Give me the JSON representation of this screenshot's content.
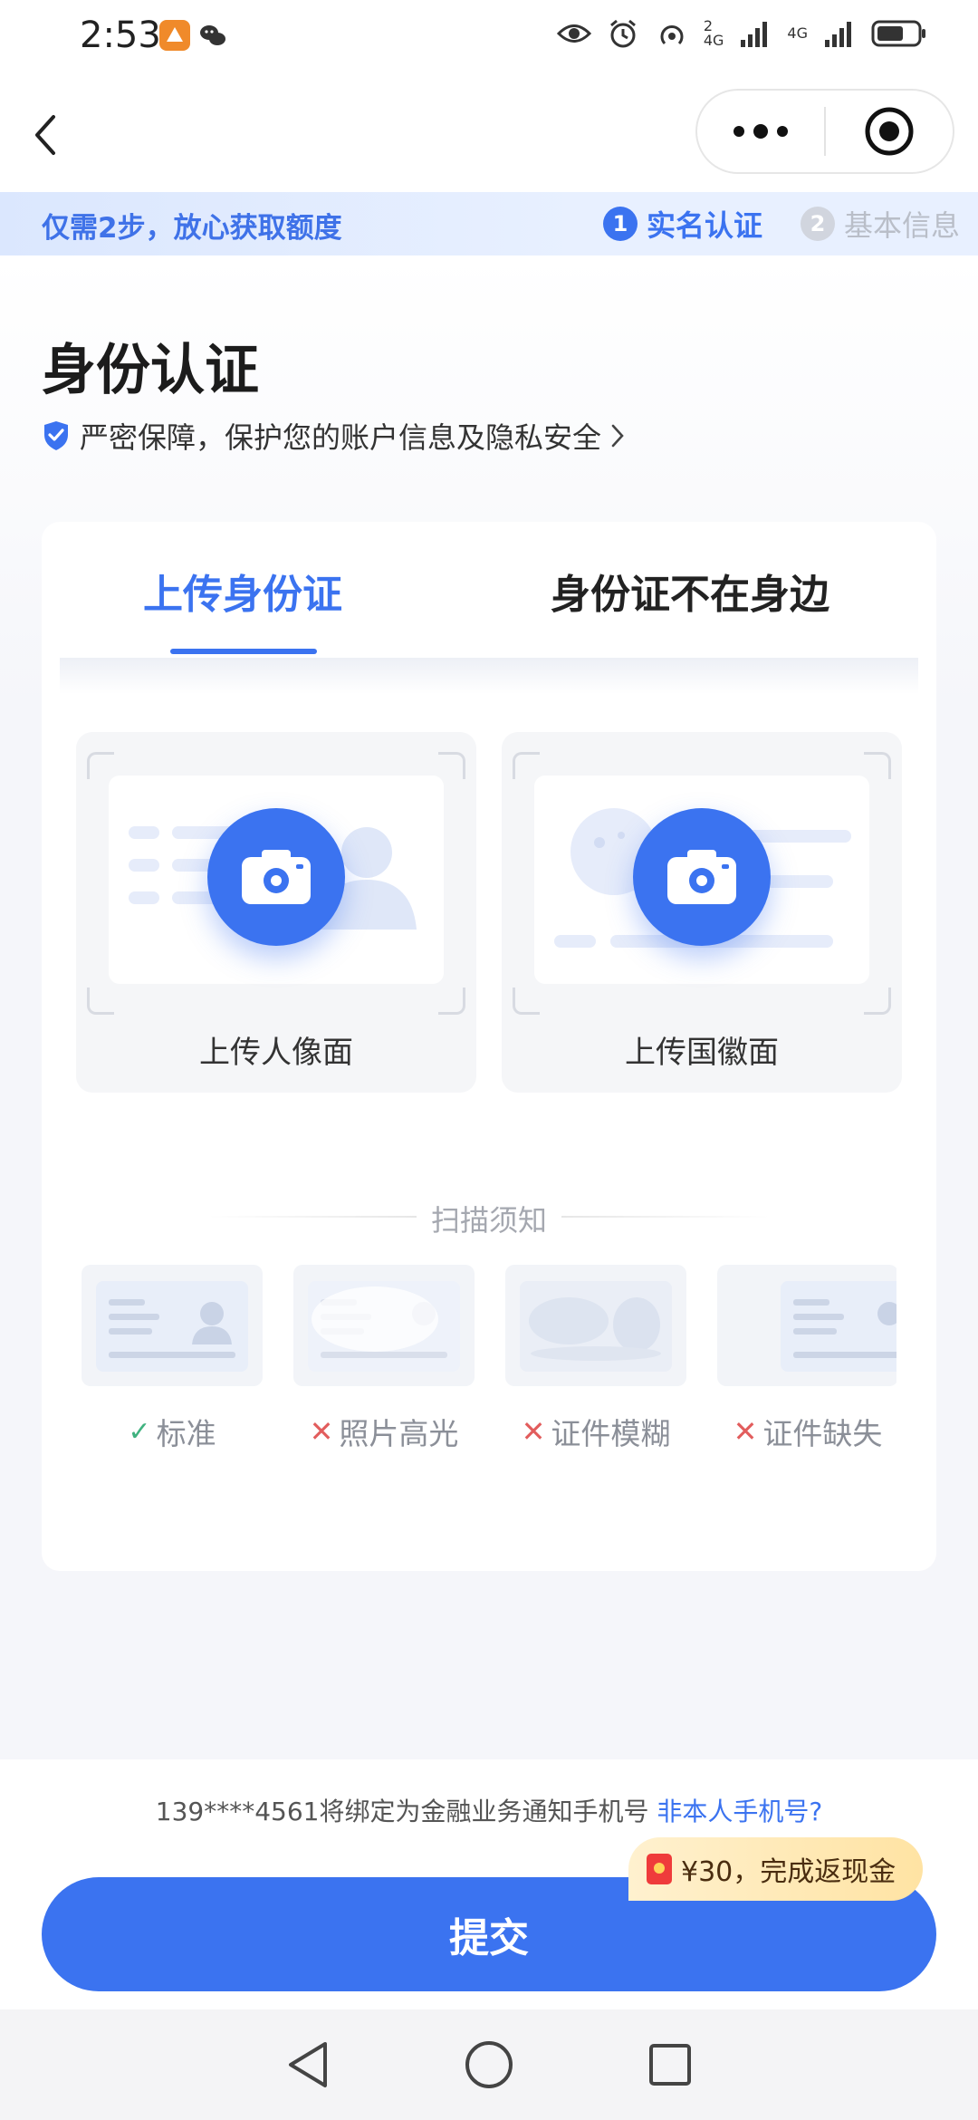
{
  "status_bar": {
    "time": "2:53",
    "net_1_sup": "2",
    "net_1_type": "4G",
    "net_2_type": "4G",
    "icons": [
      "app-notification-icon",
      "wechat-icon",
      "eye-icon",
      "alarm-icon",
      "hotspot-icon",
      "signal-icon",
      "signal-icon",
      "battery-icon"
    ]
  },
  "nav": {
    "icons": [
      "back-arrow-icon",
      "more-dots-icon",
      "mini-program-close-icon"
    ]
  },
  "steps": {
    "tagline": "仅需2步，放心获取额度",
    "items": [
      {
        "num": "1",
        "label": "实名认证",
        "active": true
      },
      {
        "num": "2",
        "label": "基本信息",
        "active": false
      }
    ]
  },
  "header": {
    "title": "身份认证",
    "security_text": "严密保障，保护您的账户信息及隐私安全",
    "security_icon": "shield-check-icon"
  },
  "tabs": [
    {
      "label": "上传身份证",
      "active": true
    },
    {
      "label": "身份证不在身边",
      "active": false
    }
  ],
  "upload": {
    "portrait_label": "上传人像面",
    "emblem_label": "上传国徽面"
  },
  "notice": {
    "title": "扫描须知",
    "samples": [
      {
        "label": "标准",
        "ok": true
      },
      {
        "label": "照片高光",
        "ok": false
      },
      {
        "label": "证件模糊",
        "ok": false
      },
      {
        "label": "证件缺失",
        "ok": false
      }
    ]
  },
  "footer": {
    "binding_text": "139****4561将绑定为金融业务通知手机号",
    "binding_link": "非本人手机号?",
    "cashback": "¥30，完成返现金",
    "submit": "提交"
  },
  "colors": {
    "primary": "#3b73f0",
    "ok": "#3fb27f",
    "bad": "#e25d5d",
    "cashback_bg": "#ffe3a3"
  },
  "system_nav": {
    "icons": [
      "back-triangle-icon",
      "home-circle-icon",
      "recents-square-icon"
    ]
  }
}
